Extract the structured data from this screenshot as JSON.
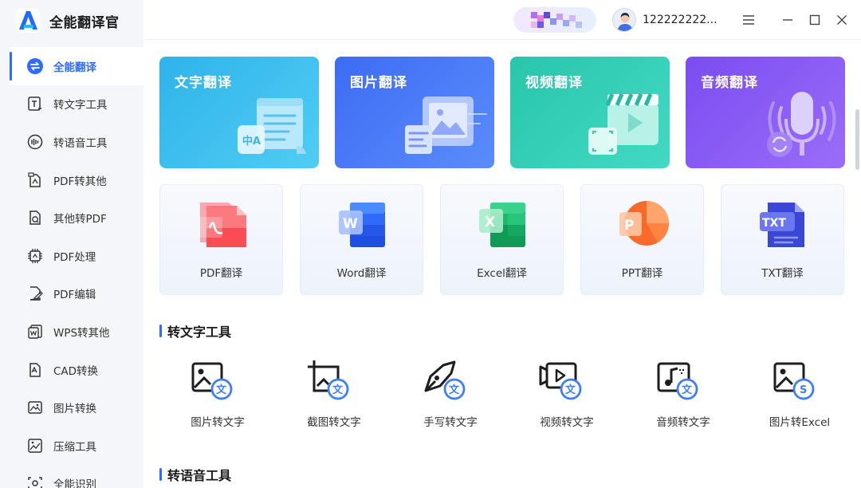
{
  "app": {
    "title": "全能翻译官"
  },
  "titlebar": {
    "username": "122222222..."
  },
  "sidebar": {
    "items": [
      {
        "label": "全能翻译",
        "icon": "translate-icon",
        "active": true
      },
      {
        "label": "转文字工具",
        "icon": "text-tool-icon"
      },
      {
        "label": "转语音工具",
        "icon": "voice-tool-icon"
      },
      {
        "label": "PDF转其他",
        "icon": "pdf-convert-icon"
      },
      {
        "label": "其他转PDF",
        "icon": "to-pdf-icon"
      },
      {
        "label": "PDF处理",
        "icon": "pdf-process-icon"
      },
      {
        "label": "PDF编辑",
        "icon": "pdf-edit-icon"
      },
      {
        "label": "WPS转其他",
        "icon": "wps-convert-icon"
      },
      {
        "label": "CAD转换",
        "icon": "cad-convert-icon"
      },
      {
        "label": "图片转换",
        "icon": "image-convert-icon"
      },
      {
        "label": "压缩工具",
        "icon": "compress-icon"
      },
      {
        "label": "全能识别",
        "icon": "recognize-icon"
      }
    ]
  },
  "main": {
    "big_cards": [
      {
        "label": "文字翻译",
        "icon": "text-translate-icon"
      },
      {
        "label": "图片翻译",
        "icon": "image-translate-icon"
      },
      {
        "label": "视频翻译",
        "icon": "video-translate-icon"
      },
      {
        "label": "音频翻译",
        "icon": "audio-translate-icon"
      }
    ],
    "doc_cards": [
      {
        "label": "PDF翻译",
        "icon": "pdf-file-icon"
      },
      {
        "label": "Word翻译",
        "icon": "word-file-icon"
      },
      {
        "label": "Excel翻译",
        "icon": "excel-file-icon"
      },
      {
        "label": "PPT翻译",
        "icon": "ppt-file-icon"
      },
      {
        "label": "TXT翻译",
        "icon": "txt-file-icon",
        "badge": "TXT"
      }
    ],
    "section_text": {
      "title": "转文字工具",
      "items": [
        {
          "label": "图片转文字",
          "icon": "image-to-text-icon"
        },
        {
          "label": "截图转文字",
          "icon": "screenshot-to-text-icon"
        },
        {
          "label": "手写转文字",
          "icon": "handwriting-to-text-icon"
        },
        {
          "label": "视频转文字",
          "icon": "video-to-text-icon"
        },
        {
          "label": "音频转文字",
          "icon": "audio-to-text-icon"
        },
        {
          "label": "图片转Excel",
          "icon": "image-to-excel-icon"
        }
      ]
    },
    "section_voice": {
      "title": "转语音工具"
    }
  },
  "colors": {
    "accent": "#2f6bff",
    "text_card": "#2fb3ea",
    "image_card": "#3d6cf3",
    "video_card": "#28c6aa",
    "audio_card": "#7b4cf1",
    "sidebar_bg": "#f4f6f9"
  }
}
